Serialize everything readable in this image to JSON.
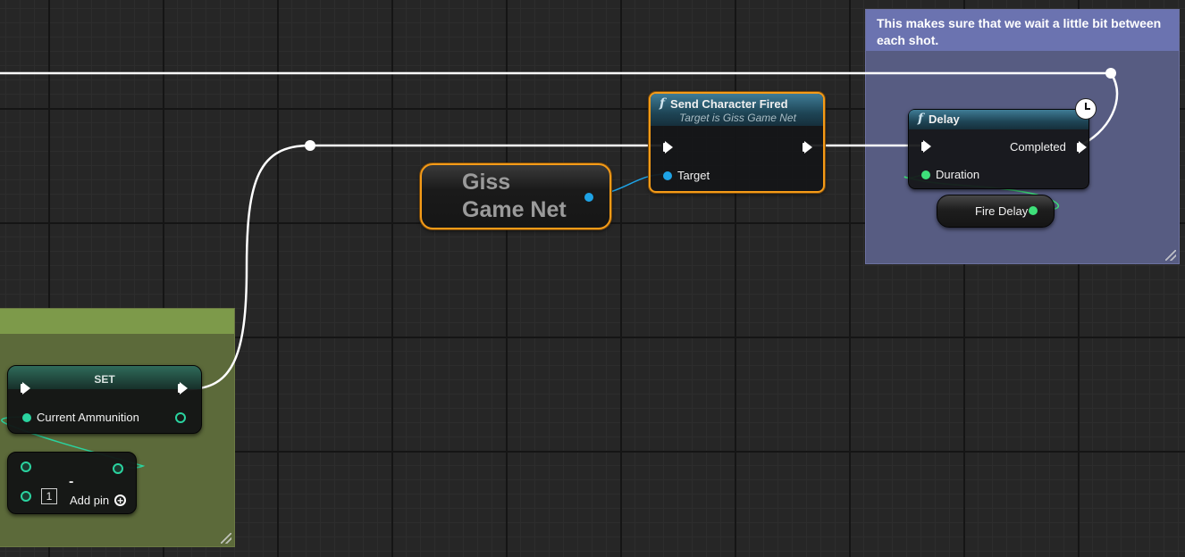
{
  "comments": {
    "delay_comment": "This makes sure that we wait a little bit between each shot."
  },
  "nodes": {
    "send_character_fired": {
      "title": "Send Character Fired",
      "subtitle": "Target is Giss Game Net",
      "pin_target": "Target"
    },
    "giss_game_net": {
      "title": "Giss Game Net"
    },
    "delay": {
      "title": "Delay",
      "pin_completed": "Completed",
      "pin_duration": "Duration"
    },
    "fire_delay": {
      "label": "Fire Delay"
    },
    "set": {
      "title": "SET",
      "pin_variable": "Current Ammunition"
    },
    "subtract": {
      "title": "-",
      "value": "1",
      "add_pin": "Add pin"
    }
  },
  "icons": {
    "function": "f",
    "add": "+"
  },
  "colors": {
    "exec_wire": "#ffffff",
    "object_pin": "#1ea3e6",
    "float_pin": "#3ee07a",
    "int_pin": "#2ad39f",
    "selection": "#f59b18",
    "comment_blue": "#6b73b0",
    "comment_green": "#7d9a4a"
  }
}
